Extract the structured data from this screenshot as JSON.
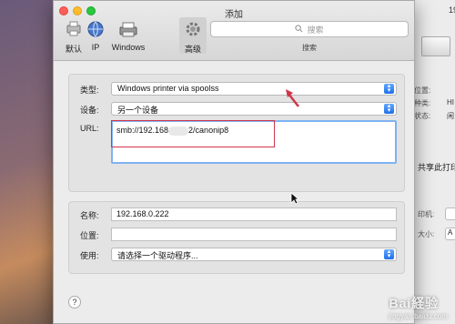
{
  "window": {
    "title": "添加"
  },
  "toolbar": {
    "items": [
      {
        "label": "默认",
        "icon": "default-printer-icon"
      },
      {
        "label": "IP",
        "icon": "ip-globe-icon"
      },
      {
        "label": "Windows",
        "icon": "windows-printer-icon"
      },
      {
        "label": "高级",
        "icon": "gear-icon",
        "selected": true
      }
    ],
    "search_placeholder": "搜索",
    "search_caption": "搜索"
  },
  "form_top": {
    "type_label": "类型:",
    "type_value": "Windows printer via spoolss",
    "device_label": "设备:",
    "device_value": "另一个设备",
    "url_label": "URL:",
    "url_prefix": "smb://192.168",
    "url_suffix": "2/canonip8"
  },
  "form_bottom": {
    "name_label": "名称:",
    "name_value": "192.168.0.222",
    "location_label": "位置:",
    "location_value": "",
    "use_label": "使用:",
    "use_value": "请选择一个驱动程序..."
  },
  "help_button": "?",
  "background_window": {
    "title_fragment": "19",
    "location_label": "位置:",
    "kind_label": "种类:",
    "kind_value": "HI",
    "status_label": "状态:",
    "status_value": "闲",
    "share_text": "共享此打印",
    "printer_label": "印机:",
    "size_label": "大小:",
    "size_value": "A"
  },
  "watermark": {
    "text": "Bai経验",
    "sub": "jingyan.baidu.com"
  },
  "colors": {
    "accent": "#1f6fe8",
    "annotation": "#d0364a"
  }
}
